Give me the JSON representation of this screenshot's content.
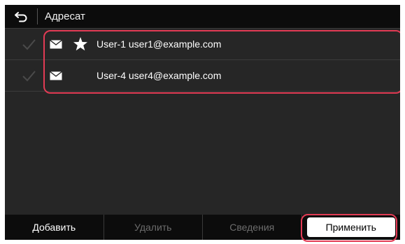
{
  "header": {
    "back_icon": "back-arrow-icon",
    "title": "Адресат"
  },
  "recipients": [
    {
      "icon": "envelope-icon",
      "favorite": true,
      "text": "User-1 user1@example.com"
    },
    {
      "icon": "envelope-icon",
      "favorite": false,
      "text": "User-4 user4@example.com"
    }
  ],
  "footer": {
    "add_label": "Добавить",
    "delete_label": "Удалить",
    "details_label": "Сведения",
    "apply_label": "Применить"
  },
  "colors": {
    "highlight": "#e23b54",
    "background": "#262626",
    "bar": "#0c0c0c"
  }
}
